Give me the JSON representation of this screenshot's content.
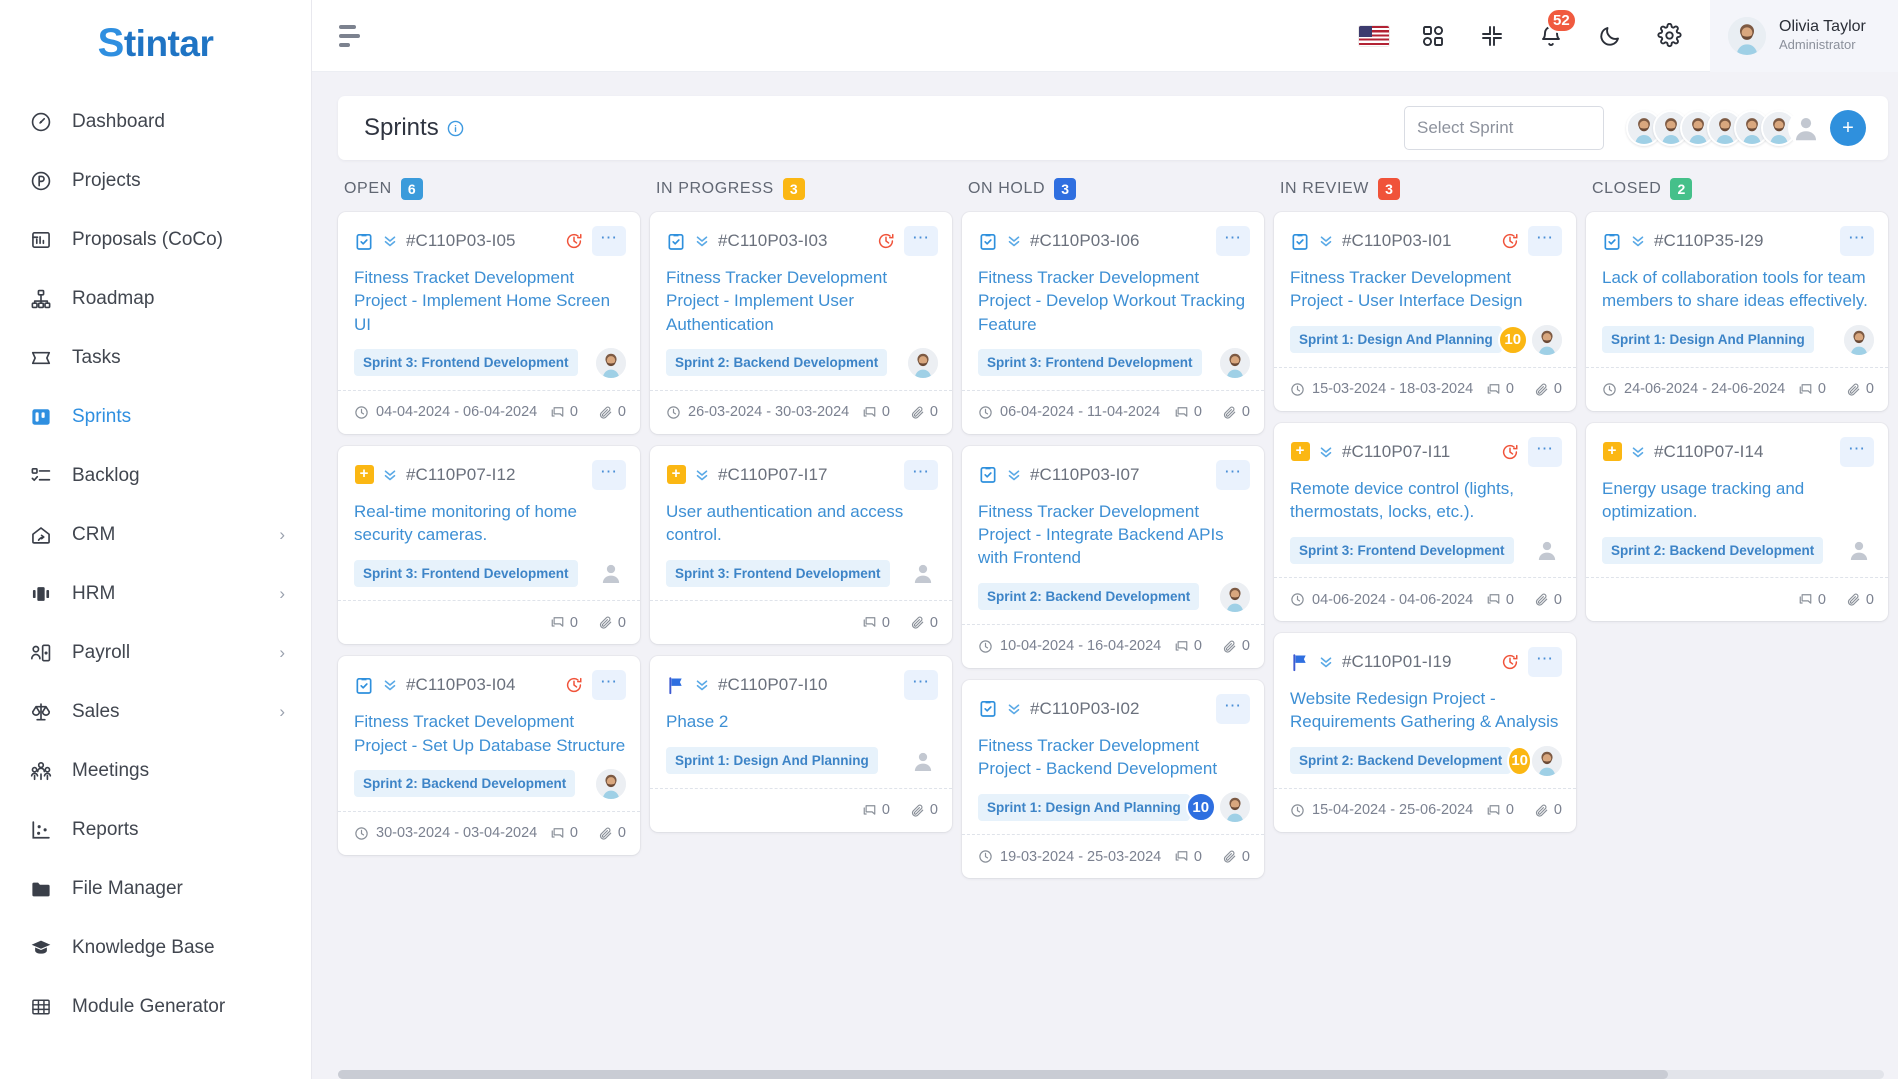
{
  "brand": {
    "prefix": "S",
    "rest": "tintar",
    "logo_color": "#1f74c4"
  },
  "sidebar": {
    "items": [
      {
        "label": "Dashboard",
        "icon": "gauge-icon",
        "active": false,
        "expandable": false
      },
      {
        "label": "Projects",
        "icon": "projects-icon",
        "active": false,
        "expandable": false
      },
      {
        "label": "Proposals (CoCo)",
        "icon": "proposals-icon",
        "active": false,
        "expandable": false
      },
      {
        "label": "Roadmap",
        "icon": "roadmap-icon",
        "active": false,
        "expandable": false
      },
      {
        "label": "Tasks",
        "icon": "tasks-icon",
        "active": false,
        "expandable": false
      },
      {
        "label": "Sprints",
        "icon": "sprints-icon",
        "active": true,
        "expandable": false
      },
      {
        "label": "Backlog",
        "icon": "backlog-icon",
        "active": false,
        "expandable": false
      },
      {
        "label": "CRM",
        "icon": "crm-icon",
        "active": false,
        "expandable": true
      },
      {
        "label": "HRM",
        "icon": "hrm-icon",
        "active": false,
        "expandable": true
      },
      {
        "label": "Payroll",
        "icon": "payroll-icon",
        "active": false,
        "expandable": true
      },
      {
        "label": "Sales",
        "icon": "sales-icon",
        "active": false,
        "expandable": true
      },
      {
        "label": "Meetings",
        "icon": "meetings-icon",
        "active": false,
        "expandable": false
      },
      {
        "label": "Reports",
        "icon": "reports-icon",
        "active": false,
        "expandable": false
      },
      {
        "label": "File Manager",
        "icon": "folder-icon",
        "active": false,
        "expandable": false
      },
      {
        "label": "Knowledge Base",
        "icon": "graduation-cap-icon",
        "active": false,
        "expandable": false
      },
      {
        "label": "Module Generator",
        "icon": "grid-icon",
        "active": false,
        "expandable": false
      }
    ],
    "caret_glyph": "›"
  },
  "topbar": {
    "menu_icon": "hamburger-icon",
    "icons": [
      {
        "name": "language-flag-icon",
        "label": "US"
      },
      {
        "name": "apps-grid-icon",
        "label": ""
      },
      {
        "name": "collapse-fullscreen-icon",
        "label": ""
      },
      {
        "name": "bell-icon",
        "label": ""
      },
      {
        "name": "dark-mode-moon-icon",
        "label": ""
      },
      {
        "name": "gear-icon",
        "label": ""
      }
    ],
    "notification_count": "52",
    "notification_badge_color": "#f05a3f",
    "user": {
      "name": "Olivia Taylor",
      "role": "Administrator"
    }
  },
  "page": {
    "title": "Sprints",
    "info_icon": "info-circle-icon",
    "select_sprint_placeholder": "Select Sprint",
    "select_sprint_value": "",
    "member_avatar_count": 6,
    "add_member_label": "+"
  },
  "board": {
    "columns": [
      {
        "name": "OPEN",
        "count": "6",
        "color": "#3b9bdb",
        "cards": [
          {
            "type_icon": "clipboard-check-icon",
            "id": "#C110P03-I05",
            "title": "Fitness Tracket Development Project - Implement Home Screen UI",
            "sprint_tag": "Sprint 3: Frontend Development",
            "count_badge": "",
            "count_badge_color": "",
            "assignee": true,
            "overdue": true,
            "dates": "04-04-2024 - 06-04-2024",
            "comments": "0",
            "attachments": "0"
          },
          {
            "type_icon": "plus-square-icon",
            "id": "#C110P07-I12",
            "title": "Real-time monitoring of home security cameras.",
            "sprint_tag": "Sprint 3: Frontend Development",
            "count_badge": "",
            "count_badge_color": "",
            "assignee": false,
            "overdue": false,
            "dates": "",
            "comments": "0",
            "attachments": "0"
          },
          {
            "type_icon": "clipboard-check-icon",
            "id": "#C110P03-I04",
            "title": "Fitness Tracket Development Project - Set Up Database Structure",
            "sprint_tag": "Sprint 2: Backend Development",
            "count_badge": "",
            "count_badge_color": "",
            "assignee": true,
            "overdue": true,
            "dates": "30-03-2024 - 03-04-2024",
            "comments": "0",
            "attachments": "0"
          }
        ]
      },
      {
        "name": "IN PROGRESS",
        "count": "3",
        "color": "#fbb713",
        "cards": [
          {
            "type_icon": "clipboard-check-icon",
            "id": "#C110P03-I03",
            "title": "Fitness Tracker Development Project - Implement User Authentication",
            "sprint_tag": "Sprint 2: Backend Development",
            "count_badge": "",
            "count_badge_color": "",
            "assignee": true,
            "overdue": true,
            "dates": "26-03-2024 - 30-03-2024",
            "comments": "0",
            "attachments": "0"
          },
          {
            "type_icon": "plus-square-icon",
            "id": "#C110P07-I17",
            "title": "User authentication and access control.",
            "sprint_tag": "Sprint 3: Frontend Development",
            "count_badge": "",
            "count_badge_color": "",
            "assignee": false,
            "overdue": false,
            "dates": "",
            "comments": "0",
            "attachments": "0"
          },
          {
            "type_icon": "flag-icon",
            "id": "#C110P07-I10",
            "title": "Phase 2",
            "sprint_tag": "Sprint 1: Design And Planning",
            "count_badge": "",
            "count_badge_color": "",
            "assignee": false,
            "overdue": false,
            "dates": "",
            "comments": "0",
            "attachments": "0"
          }
        ]
      },
      {
        "name": "ON HOLD",
        "count": "3",
        "color": "#2f6fe0",
        "cards": [
          {
            "type_icon": "clipboard-check-icon",
            "id": "#C110P03-I06",
            "title": "Fitness Tracker Development Project - Develop Workout Tracking Feature",
            "sprint_tag": "Sprint 3: Frontend Development",
            "count_badge": "",
            "count_badge_color": "",
            "assignee": true,
            "overdue": false,
            "dates": "06-04-2024 - 11-04-2024",
            "comments": "0",
            "attachments": "0"
          },
          {
            "type_icon": "clipboard-check-icon",
            "id": "#C110P03-I07",
            "title": "Fitness Tracker Development Project - Integrate Backend APIs with Frontend",
            "sprint_tag": "Sprint 2: Backend Development",
            "count_badge": "",
            "count_badge_color": "",
            "assignee": true,
            "overdue": false,
            "dates": "10-04-2024 - 16-04-2024",
            "comments": "0",
            "attachments": "0"
          },
          {
            "type_icon": "clipboard-check-icon",
            "id": "#C110P03-I02",
            "title": "Fitness Tracker Development Project - Backend Development",
            "sprint_tag": "Sprint 1: Design And Planning",
            "count_badge": "10",
            "count_badge_color": "#2f6fe0",
            "assignee": true,
            "overdue": false,
            "dates": "19-03-2024 - 25-03-2024",
            "comments": "0",
            "attachments": "0"
          }
        ]
      },
      {
        "name": "IN REVIEW",
        "count": "3",
        "color": "#f0533a",
        "cards": [
          {
            "type_icon": "clipboard-check-icon",
            "id": "#C110P03-I01",
            "title": "Fitness Tracker Development Project - User Interface Design",
            "sprint_tag": "Sprint 1: Design And Planning",
            "count_badge": "10",
            "count_badge_color": "#fbb713",
            "assignee": true,
            "overdue": true,
            "dates": "15-03-2024 - 18-03-2024",
            "comments": "0",
            "attachments": "0"
          },
          {
            "type_icon": "plus-square-icon",
            "id": "#C110P07-I11",
            "title": "Remote device control (lights, thermostats, locks, etc.).",
            "sprint_tag": "Sprint 3: Frontend Development",
            "count_badge": "",
            "count_badge_color": "",
            "assignee": false,
            "overdue": true,
            "dates": "04-06-2024 - 04-06-2024",
            "comments": "0",
            "attachments": "0"
          },
          {
            "type_icon": "flag-icon",
            "id": "#C110P01-I19",
            "title": "Website Redesign Project - Requirements Gathering & Analysis",
            "sprint_tag": "Sprint 2: Backend Development",
            "count_badge": "10",
            "count_badge_color": "#fbb713",
            "assignee": true,
            "overdue": true,
            "dates": "15-04-2024 - 25-06-2024",
            "comments": "0",
            "attachments": "0"
          }
        ]
      },
      {
        "name": "CLOSED",
        "count": "2",
        "color": "#45c08a",
        "cards": [
          {
            "type_icon": "clipboard-check-icon",
            "id": "#C110P35-I29",
            "title": "Lack of collaboration tools for team members to share ideas effectively.",
            "sprint_tag": "Sprint 1: Design And Planning",
            "count_badge": "",
            "count_badge_color": "",
            "assignee": true,
            "overdue": false,
            "dates": "24-06-2024 - 24-06-2024",
            "comments": "0",
            "attachments": "0"
          },
          {
            "type_icon": "plus-square-icon",
            "id": "#C110P07-I14",
            "title": "Energy usage tracking and optimization.",
            "sprint_tag": "Sprint 2: Backend Development",
            "count_badge": "",
            "count_badge_color": "",
            "assignee": false,
            "overdue": false,
            "dates": "",
            "comments": "0",
            "attachments": "0"
          }
        ]
      }
    ]
  }
}
